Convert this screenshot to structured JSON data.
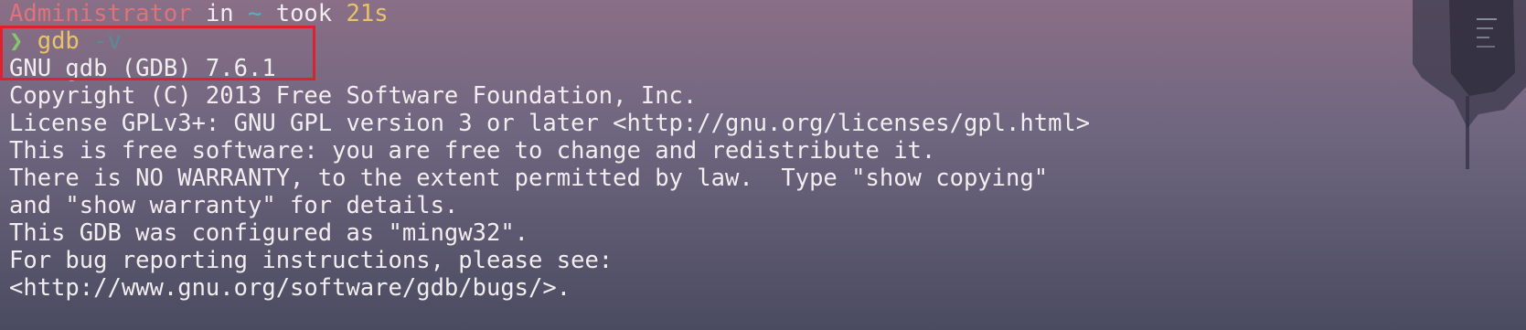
{
  "prompt": {
    "user": "Administrator",
    "in_word": " in ",
    "dir": "~",
    "took_word": " took ",
    "duration": "21s"
  },
  "command": {
    "chevron": "❯",
    "name": "gdb",
    "flag": "-v"
  },
  "output": [
    "GNU gdb (GDB) 7.6.1",
    "Copyright (C) 2013 Free Software Foundation, Inc.",
    "License GPLv3+: GNU GPL version 3 or later <http://gnu.org/licenses/gpl.html>",
    "This is free software: you are free to change and redistribute it.",
    "There is NO WARRANTY, to the extent permitted by law.  Type \"show copying\"",
    "and \"show warranty\" for details.",
    "This GDB was configured as \"mingw32\".",
    "For bug reporting instructions, please see:",
    "<http://www.gnu.org/software/gdb/bugs/>."
  ],
  "colors": {
    "highlight_border": "#e0212b",
    "user": "#e0727c",
    "directory": "#45b8c8",
    "duration": "#e9c36a",
    "chevron": "#89c46f",
    "command": "#e9c36a",
    "flag": "#5b8a97",
    "text": "#f2eef0"
  }
}
